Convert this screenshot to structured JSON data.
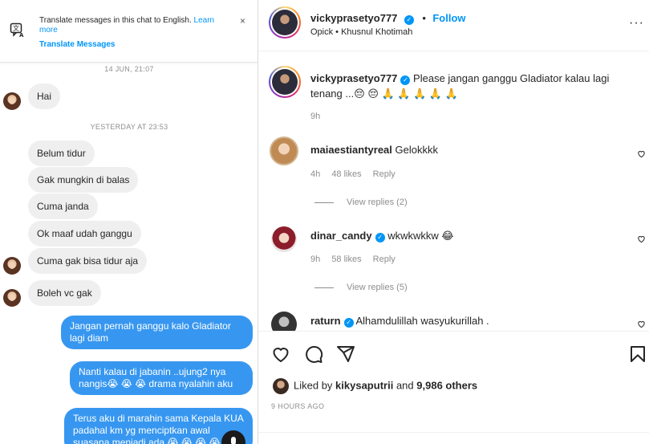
{
  "dm": {
    "translate": {
      "text": "Translate messages in this chat to English.",
      "learn_more": "Learn more",
      "action": "Translate Messages",
      "close": "×"
    },
    "timestamps": [
      "14 JUN, 21:07",
      "YESTERDAY AT 23:53"
    ],
    "incoming": [
      "Hai",
      "Belum tidur",
      "Gak mungkin di balas",
      "Cuma janda",
      "Ok maaf udah ganggu",
      "Cuma gak bisa tidur aja",
      "Boleh vc gak"
    ],
    "outgoing": [
      "Jangan pernah ganggu kalo Gladiator lagi diam",
      "Nanti kalau di jabanin ..ujung2 nya nangis😭 😭 😭 drama nyalahin aku",
      "Terus aku di marahin sama Kepala KUA padahal km yg menciptkan awal suasana menjadi ada 😭 😭 😭 😭"
    ]
  },
  "post": {
    "header": {
      "username": "vickyprasetyo777",
      "verified_mark": "✓",
      "separator": "•",
      "follow": "Follow",
      "subtitle": "Opick • Khusnul Khotimah",
      "more": "···"
    },
    "caption": {
      "username": "vickyprasetyo777",
      "text": "Please jangan ganggu Gladiator kalau lagi tenang ...😔 😔 🙏 🙏 🙏 🙏 🙏",
      "time": "9h"
    },
    "comments": [
      {
        "username": "maiaestiantyreal",
        "text": "Gelokkkk",
        "time": "4h",
        "likes": "48 likes",
        "reply": "Reply",
        "view_replies": "View replies (2)"
      },
      {
        "username": "dinar_candy",
        "text": "wkwkwkkw 😂",
        "time": "9h",
        "likes": "58 likes",
        "reply": "Reply",
        "view_replies": "View replies (5)"
      },
      {
        "username": "raturn",
        "text": "Alhamdulillah wasyukurillah ."
      }
    ],
    "liked_by": {
      "prefix": "Liked by",
      "user": "kikysaputrii",
      "and": "and",
      "others": "9,986 others"
    },
    "time_ago": "9 HOURS AGO"
  }
}
